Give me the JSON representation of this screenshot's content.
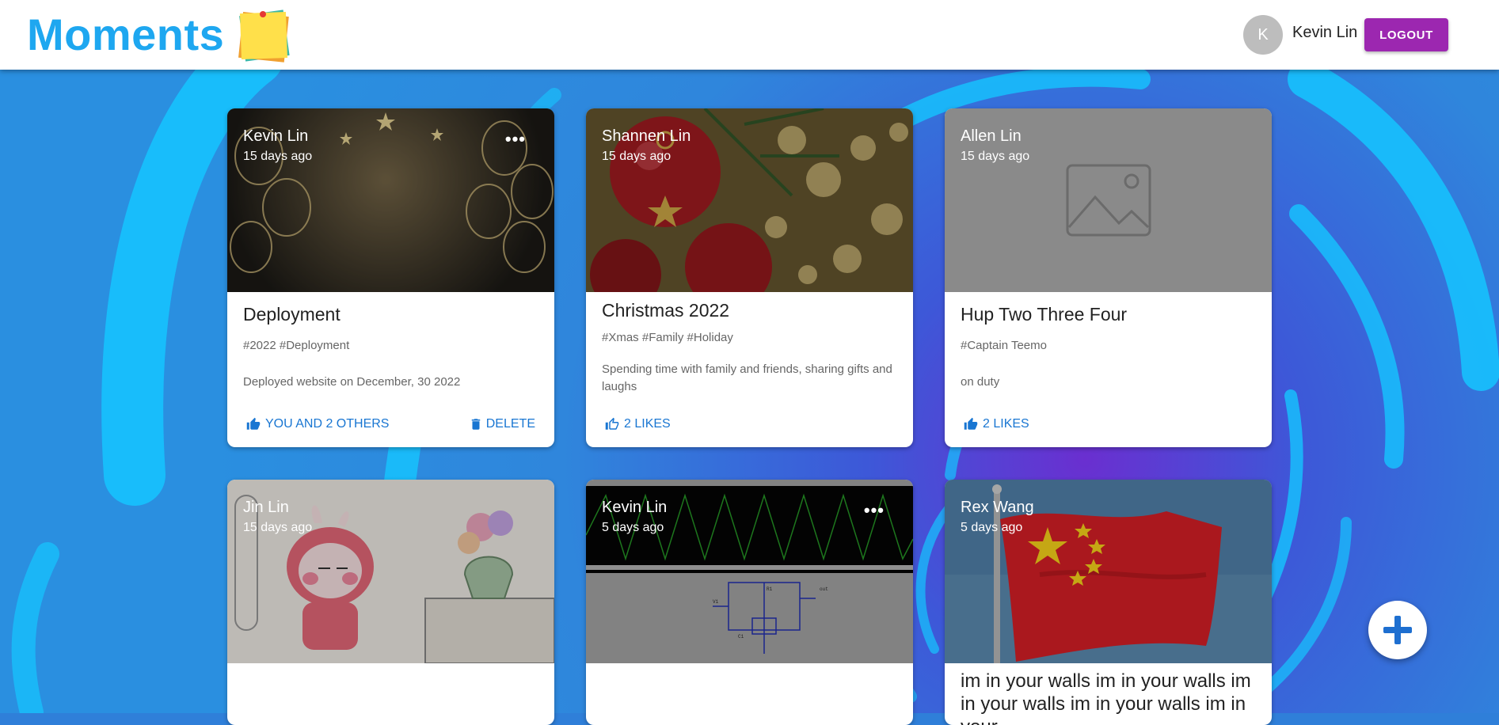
{
  "header": {
    "brand": "Moments",
    "user_initial": "K",
    "user_name": "Kevin Lin",
    "logout_label": "LOGOUT"
  },
  "colors": {
    "brand": "#1ea7f0",
    "logout": "#9c27b0",
    "link": "#1976d2"
  },
  "posts": [
    {
      "author": "Kevin Lin",
      "time": "15 days ago",
      "more": "•••",
      "title": "Deployment",
      "tags": "#2022 #Deployment",
      "message": "Deployed website on December, 30 2022",
      "likes": "YOU AND 2 OTHERS",
      "delete": "DELETE",
      "image": "gold-balloons"
    },
    {
      "author": "Shannen Lin",
      "time": "15 days ago",
      "title": "Christmas 2022",
      "tags": "#Xmas #Family #Holiday",
      "message": "Spending time with family and friends, sharing gifts and laughs",
      "likes": "2 LIKES",
      "image": "christmas-ornaments"
    },
    {
      "author": "Allen Lin",
      "time": "15 days ago",
      "title": "Hup Two Three Four",
      "tags": "#Captain Teemo",
      "message": "on duty",
      "likes": "2 LIKES",
      "image": "placeholder-image"
    },
    {
      "author": "Jin Lin",
      "time": "15 days ago",
      "image": "cartoon-bunny"
    },
    {
      "author": "Kevin Lin",
      "time": "5 days ago",
      "more": "•••",
      "image": "circuit-waveform"
    },
    {
      "author": "Rex Wang",
      "time": "5 days ago",
      "title": "im in your walls im in your walls im in your walls im in your walls im in your",
      "image": "flag"
    }
  ],
  "fab": {
    "icon": "plus-icon"
  }
}
